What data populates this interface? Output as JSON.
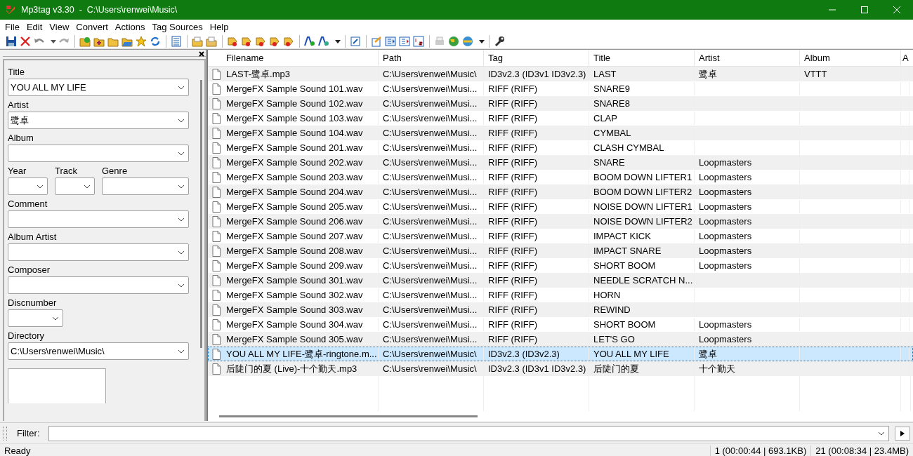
{
  "window": {
    "title": "Mp3tag v3.30  -  C:\\Users\\renwei\\Music\\"
  },
  "menu": [
    "File",
    "Edit",
    "View",
    "Convert",
    "Actions",
    "Tag Sources",
    "Help"
  ],
  "tag_panel": {
    "rows": [
      [
        {
          "label": "Title",
          "value": "YOU ALL MY LIFE",
          "kind": "wide"
        }
      ],
      [
        {
          "label": "Artist",
          "value": "鹭卓",
          "kind": "wide"
        }
      ],
      [
        {
          "label": "Album",
          "kind": "wide"
        }
      ],
      [
        {
          "label": "Year",
          "kind": "short"
        },
        {
          "label": "Track",
          "kind": "short"
        },
        {
          "label": "Genre",
          "kind": "medium"
        }
      ],
      [
        {
          "label": "Comment",
          "kind": "wide"
        }
      ],
      [
        {
          "label": "Album Artist",
          "kind": "wide"
        }
      ],
      [
        {
          "label": "Composer",
          "kind": "wide"
        }
      ],
      [
        {
          "label": "Discnumber",
          "kind": "narrow"
        }
      ],
      [
        {
          "label": "Directory",
          "value": "C:\\Users\\renwei\\Music\\",
          "kind": "wide"
        }
      ]
    ]
  },
  "table": {
    "columns": [
      "Filename",
      "Path",
      "Tag",
      "Title",
      "Artist",
      "Album",
      "A"
    ],
    "rows": [
      {
        "cells": [
          "LAST-鹭卓.mp3",
          "C:\\Users\\renwei\\Music\\",
          "ID3v2.3 (ID3v1 ID3v2.3)",
          "LAST",
          "鹭卓",
          "VTTT"
        ],
        "selected": false
      },
      {
        "cells": [
          "MergeFX Sample Sound 101.wav",
          "C:\\Users\\renwei\\Musi...",
          "RIFF (RIFF)",
          "SNARE9"
        ],
        "selected": false
      },
      {
        "cells": [
          "MergeFX Sample Sound 102.wav",
          "C:\\Users\\renwei\\Musi...",
          "RIFF (RIFF)",
          "SNARE8"
        ],
        "selected": false
      },
      {
        "cells": [
          "MergeFX Sample Sound 103.wav",
          "C:\\Users\\renwei\\Musi...",
          "RIFF (RIFF)",
          "CLAP"
        ],
        "selected": false
      },
      {
        "cells": [
          "MergeFX Sample Sound 104.wav",
          "C:\\Users\\renwei\\Musi...",
          "RIFF (RIFF)",
          "CYMBAL"
        ],
        "selected": false
      },
      {
        "cells": [
          "MergeFX Sample Sound 201.wav",
          "C:\\Users\\renwei\\Musi...",
          "RIFF (RIFF)",
          "CLASH CYMBAL"
        ],
        "selected": false
      },
      {
        "cells": [
          "MergeFX Sample Sound 202.wav",
          "C:\\Users\\renwei\\Musi...",
          "RIFF (RIFF)",
          "SNARE",
          "Loopmasters"
        ],
        "selected": false
      },
      {
        "cells": [
          "MergeFX Sample Sound 203.wav",
          "C:\\Users\\renwei\\Musi...",
          "RIFF (RIFF)",
          "BOOM DOWN LIFTER1",
          "Loopmasters"
        ],
        "selected": false
      },
      {
        "cells": [
          "MergeFX Sample Sound 204.wav",
          "C:\\Users\\renwei\\Musi...",
          "RIFF (RIFF)",
          "BOOM DOWN LIFTER2",
          "Loopmasters"
        ],
        "selected": false
      },
      {
        "cells": [
          "MergeFX Sample Sound 205.wav",
          "C:\\Users\\renwei\\Musi...",
          "RIFF (RIFF)",
          "NOISE DOWN LIFTER1",
          "Loopmasters"
        ],
        "selected": false
      },
      {
        "cells": [
          "MergeFX Sample Sound 206.wav",
          "C:\\Users\\renwei\\Musi...",
          "RIFF (RIFF)",
          "NOISE DOWN LIFTER2",
          "Loopmasters"
        ],
        "selected": false
      },
      {
        "cells": [
          "MergeFX Sample Sound 207.wav",
          "C:\\Users\\renwei\\Musi...",
          "RIFF (RIFF)",
          "IMPACT KICK",
          "Loopmasters"
        ],
        "selected": false
      },
      {
        "cells": [
          "MergeFX Sample Sound 208.wav",
          "C:\\Users\\renwei\\Musi...",
          "RIFF (RIFF)",
          "IMPACT SNARE",
          "Loopmasters"
        ],
        "selected": false
      },
      {
        "cells": [
          "MergeFX Sample Sound 209.wav",
          "C:\\Users\\renwei\\Musi...",
          "RIFF (RIFF)",
          "SHORT BOOM",
          "Loopmasters"
        ],
        "selected": false
      },
      {
        "cells": [
          "MergeFX Sample Sound 301.wav",
          "C:\\Users\\renwei\\Musi...",
          "RIFF (RIFF)",
          "NEEDLE SCRATCH N..."
        ],
        "selected": false
      },
      {
        "cells": [
          "MergeFX Sample Sound 302.wav",
          "C:\\Users\\renwei\\Musi...",
          "RIFF (RIFF)",
          "HORN"
        ],
        "selected": false
      },
      {
        "cells": [
          "MergeFX Sample Sound 303.wav",
          "C:\\Users\\renwei\\Musi...",
          "RIFF (RIFF)",
          "REWIND"
        ],
        "selected": false
      },
      {
        "cells": [
          "MergeFX Sample Sound 304.wav",
          "C:\\Users\\renwei\\Musi...",
          "RIFF (RIFF)",
          "SHORT BOOM",
          "Loopmasters"
        ],
        "selected": false
      },
      {
        "cells": [
          "MergeFX Sample Sound 305.wav",
          "C:\\Users\\renwei\\Musi...",
          "RIFF (RIFF)",
          "LET'S GO",
          "Loopmasters"
        ],
        "selected": false
      },
      {
        "cells": [
          "YOU ALL MY LIFE-鹭卓-ringtone.m...",
          "C:\\Users\\renwei\\Music\\",
          "ID3v2.3 (ID3v2.3)",
          "YOU ALL MY LIFE",
          "鹭卓"
        ],
        "selected": true
      },
      {
        "cells": [
          "后陡门的夏 (Live)-十个勤天.mp3",
          "C:\\Users\\renwei\\Music\\",
          "ID3v2.3 (ID3v1 ID3v2.3)",
          "后陡门的夏",
          "十个勤天"
        ],
        "selected": false
      }
    ]
  },
  "filter": {
    "label": "Filter:"
  },
  "status_bar": {
    "message": "Ready",
    "selection": "1 (00:00:44 | 693.1KB)",
    "total": "21 (00:08:34 | 23.4MB)"
  }
}
